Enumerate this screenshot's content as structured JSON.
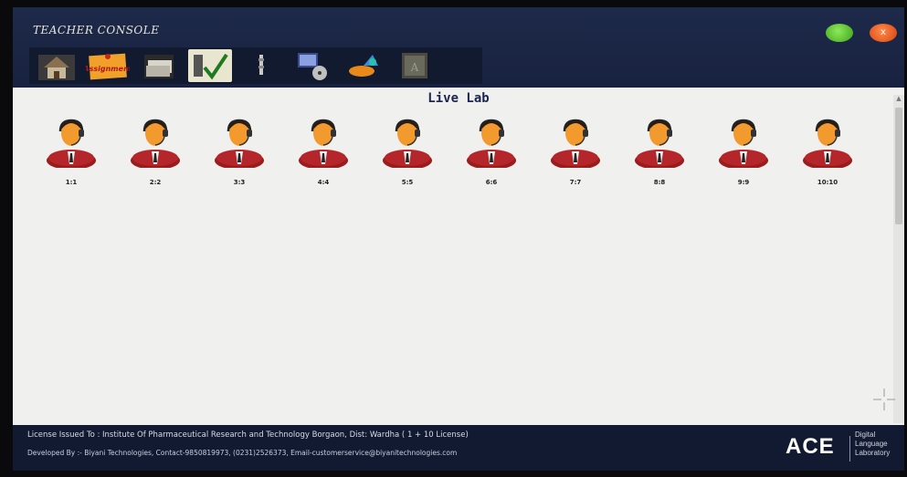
{
  "window": {
    "title": "TEACHER CONSOLE",
    "min_button": "",
    "close_button": "x"
  },
  "toolbar": {
    "items": [
      {
        "name": "home",
        "icon": "house-icon"
      },
      {
        "name": "assignment",
        "label": "Assignment",
        "icon": "assignment-note-icon"
      },
      {
        "name": "documents",
        "icon": "documents-icon"
      },
      {
        "name": "evaluation",
        "icon": "checkmark-icon",
        "active": true
      },
      {
        "name": "microphone",
        "icon": "microphone-icon"
      },
      {
        "name": "media",
        "icon": "computer-disc-icon"
      },
      {
        "name": "broadcast",
        "icon": "paint-bird-icon"
      },
      {
        "name": "exam",
        "icon": "dictionary-icon"
      }
    ]
  },
  "main": {
    "title": "Live Lab",
    "students": [
      {
        "label": "1:1"
      },
      {
        "label": "2:2"
      },
      {
        "label": "3:3"
      },
      {
        "label": "4:4"
      },
      {
        "label": "5:5"
      },
      {
        "label": "6:6"
      },
      {
        "label": "7:7"
      },
      {
        "label": "8:8"
      },
      {
        "label": "9:9"
      },
      {
        "label": "10:10"
      }
    ]
  },
  "footer": {
    "license": "License Issued To :   Institute Of Pharmaceutical Research and Technology Borgaon, Dist: Wardha ( 1 + 10 License)",
    "developer": "Developed By :- Biyani Technologies, Contact-9850819973, (0231)2526373, Email-customerservice@biyanitechnologies.com",
    "brand": "ACE",
    "brand_sub": [
      "Digital",
      "Language",
      "Laboratory"
    ]
  },
  "colors": {
    "titlebar": "#1e2a4a",
    "footer": "#111a30",
    "minimize": "#4fbf24",
    "close": "#e5531b"
  }
}
